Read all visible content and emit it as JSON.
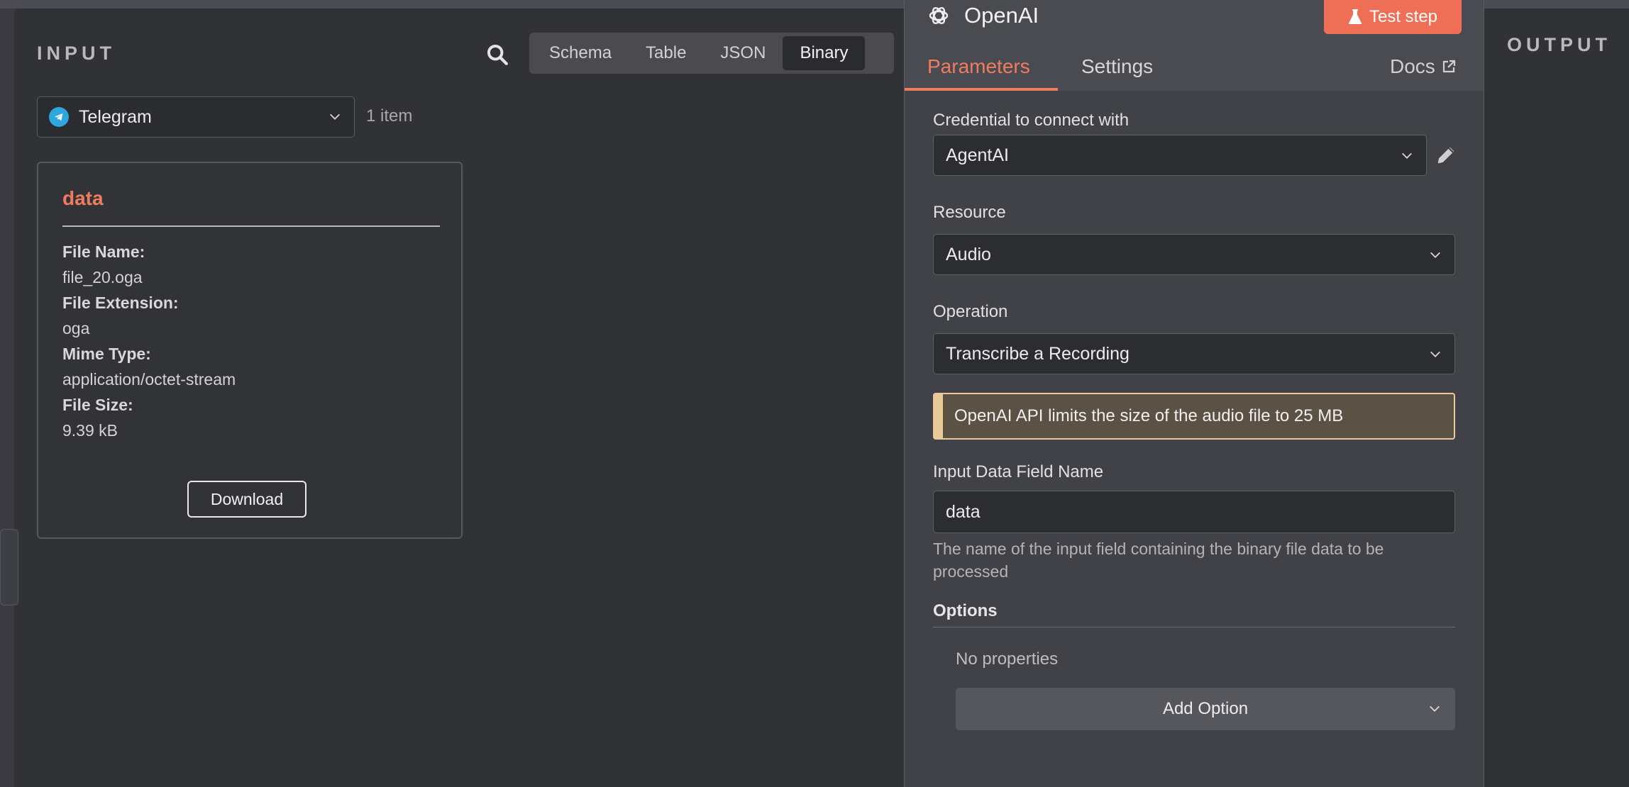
{
  "input_panel": {
    "title": "INPUT",
    "tabs": [
      {
        "label": "Schema",
        "active": false
      },
      {
        "label": "Table",
        "active": false
      },
      {
        "label": "JSON",
        "active": false
      },
      {
        "label": "Binary",
        "active": true
      }
    ],
    "node_select": {
      "value": "Telegram",
      "icon": "telegram-icon"
    },
    "item_count": "1 item",
    "card": {
      "title": "data",
      "fields": [
        {
          "label": "File Name:",
          "value": "file_20.oga"
        },
        {
          "label": "File Extension:",
          "value": "oga"
        },
        {
          "label": "Mime Type:",
          "value": "application/octet-stream"
        },
        {
          "label": "File Size:",
          "value": "9.39 kB"
        }
      ],
      "download_label": "Download"
    }
  },
  "output_panel": {
    "title": "OUTPUT"
  },
  "node": {
    "title": "OpenAI",
    "test_step_label": "Test step",
    "tabs": {
      "parameters": "Parameters",
      "settings": "Settings",
      "docs": "Docs"
    },
    "credential": {
      "label": "Credential to connect with",
      "value": "AgentAI"
    },
    "resource": {
      "label": "Resource",
      "value": "Audio"
    },
    "operation": {
      "label": "Operation",
      "value": "Transcribe a Recording"
    },
    "notice": "OpenAI API limits the size of the audio file to 25 MB",
    "input_field": {
      "label": "Input Data Field Name",
      "value": "data",
      "hint": "The name of the input field containing the binary file data to be processed"
    },
    "options": {
      "title": "Options",
      "empty_text": "No properties",
      "add_label": "Add Option"
    }
  },
  "colors": {
    "accent": "#f07c5f",
    "test_button": "#ee6e56",
    "notice_border": "#e8c997",
    "telegram": "#2ea6de"
  }
}
